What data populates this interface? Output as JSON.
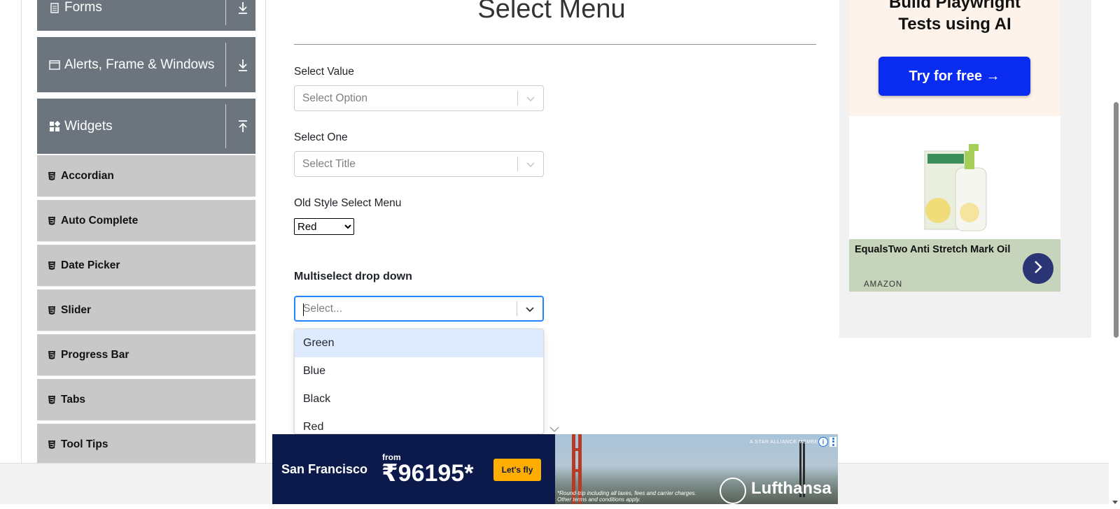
{
  "sidebar": {
    "groups": [
      {
        "label": "Forms",
        "icon": "document-icon",
        "state": "collapsed"
      },
      {
        "label": "Alerts, Frame & Windows",
        "icon": "window-icon",
        "state": "collapsed"
      },
      {
        "label": "Widgets",
        "icon": "widgets-icon",
        "state": "expanded"
      }
    ],
    "items": [
      {
        "label": "Accordian"
      },
      {
        "label": "Auto Complete"
      },
      {
        "label": "Date Picker"
      },
      {
        "label": "Slider"
      },
      {
        "label": "Progress Bar"
      },
      {
        "label": "Tabs"
      },
      {
        "label": "Tool Tips"
      }
    ]
  },
  "main": {
    "title": "Select Menu",
    "select_value": {
      "label": "Select Value",
      "placeholder": "Select Option"
    },
    "select_one": {
      "label": "Select One",
      "placeholder": "Select Title"
    },
    "old_style": {
      "label": "Old Style Select Menu",
      "selected": "Red"
    },
    "multiselect": {
      "label": "Multiselect drop down",
      "placeholder": "Select...",
      "options": [
        "Green",
        "Blue",
        "Black",
        "Red"
      ],
      "highlighted": "Green"
    }
  },
  "ad_right": {
    "headline_line1": "Build Playwright",
    "headline_line2": "Tests using AI",
    "cta": "Try for free →",
    "product_name": "EqualsTwo Anti Stretch Mark Oil",
    "source": "AMAZON",
    "cta_color": "#0a2bf0"
  },
  "banner": {
    "destination": "San Francisco",
    "from_label": "from",
    "price": "₹96195*",
    "cta": "Let's fly",
    "brand": "Lufthansa",
    "alliance": "A STAR ALLIANCE MEMBER",
    "fineprint_line1": "*Round-trip including all taxes, fees and carrier charges.",
    "fineprint_line2": "Other terms and conditions apply."
  }
}
